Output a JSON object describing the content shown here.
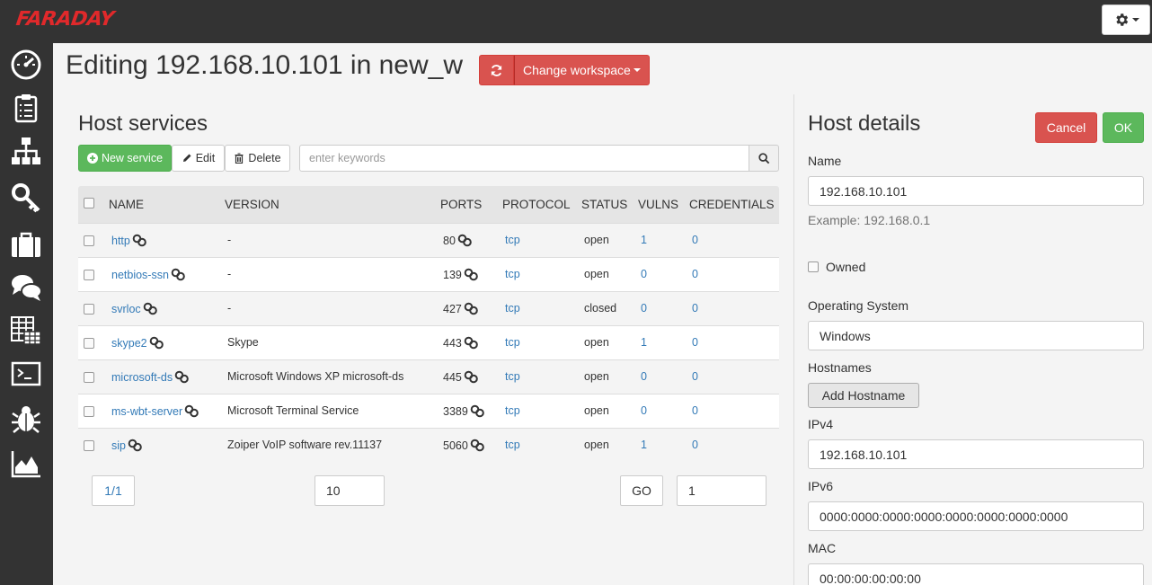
{
  "app": {
    "logo": "FARADAY"
  },
  "page": {
    "title": "Editing 192.168.10.101 in new_w",
    "workspace_button": "Change workspace"
  },
  "services": {
    "heading": "Host services",
    "new_button": "New service",
    "edit_button": "Edit",
    "delete_button": "Delete",
    "search_placeholder": "enter keywords",
    "columns": [
      "NAME",
      "VERSION",
      "PORTS",
      "PROTOCOL",
      "STATUS",
      "VULNS",
      "CREDENTIALS"
    ],
    "rows": [
      {
        "name": "http",
        "version": "-",
        "port": "80",
        "protocol": "tcp",
        "status": "open",
        "vulns": "1",
        "credentials": "0"
      },
      {
        "name": "netbios-ssn",
        "version": "-",
        "port": "139",
        "protocol": "tcp",
        "status": "open",
        "vulns": "0",
        "credentials": "0"
      },
      {
        "name": "svrloc",
        "version": "-",
        "port": "427",
        "protocol": "tcp",
        "status": "closed",
        "vulns": "0",
        "credentials": "0"
      },
      {
        "name": "skype2",
        "version": "Skype",
        "port": "443",
        "protocol": "tcp",
        "status": "open",
        "vulns": "1",
        "credentials": "0"
      },
      {
        "name": "microsoft-ds",
        "version": "Microsoft Windows XP microsoft-ds",
        "port": "445",
        "protocol": "tcp",
        "status": "open",
        "vulns": "0",
        "credentials": "0"
      },
      {
        "name": "ms-wbt-server",
        "version": "Microsoft Terminal Service",
        "port": "3389",
        "protocol": "tcp",
        "status": "open",
        "vulns": "0",
        "credentials": "0"
      },
      {
        "name": "sip",
        "version": "Zoiper VoIP software rev.11137",
        "port": "5060",
        "protocol": "tcp",
        "status": "open",
        "vulns": "1",
        "credentials": "0"
      }
    ],
    "pagination": {
      "page": "1/1",
      "page_size": "10",
      "go_button": "GO",
      "go_to_page": "1"
    }
  },
  "details": {
    "heading": "Host details",
    "cancel_button": "Cancel",
    "ok_button": "OK",
    "name_label": "Name",
    "name_value": "192.168.10.101",
    "name_hint": "Example: 192.168.0.1",
    "owned_label": "Owned",
    "os_label": "Operating System",
    "os_value": "Windows",
    "hostnames_label": "Hostnames",
    "add_hostname_button": "Add Hostname",
    "ipv4_label": "IPv4",
    "ipv4_value": "192.168.10.101",
    "ipv6_label": "IPv6",
    "ipv6_value": "0000:0000:0000:0000:0000:0000:0000:0000",
    "mac_label": "MAC",
    "mac_value": "00:00:00:00:00:00"
  },
  "sidebar_icons": [
    "dashboard-icon",
    "status-report-icon",
    "hosts-icon",
    "credentials-icon",
    "workspaces-icon",
    "communication-icon",
    "executive-report-icon",
    "console-icon",
    "vulnerability-db-icon",
    "analytics-icon"
  ],
  "colors": {
    "brand": "#e0292b",
    "dark": "#333333",
    "link": "#337ab7",
    "success": "#5cb85c",
    "danger": "#d9534f"
  }
}
